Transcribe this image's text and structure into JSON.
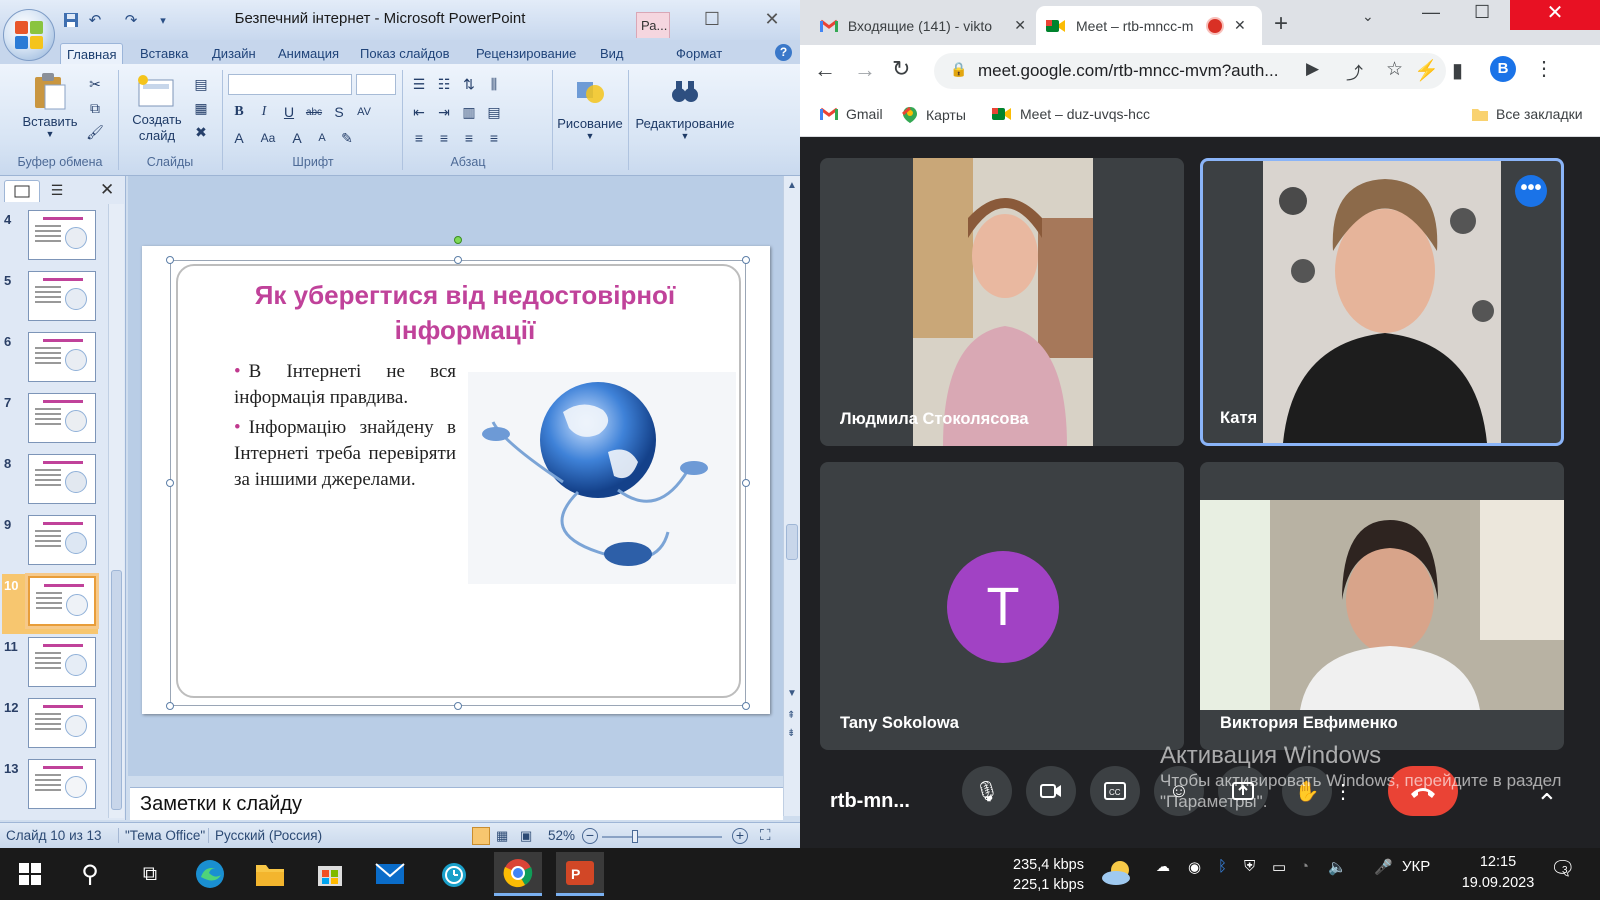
{
  "powerpoint": {
    "window_title": "Безпечний інтернет - Microsoft PowerPoint",
    "context_tab": "Ра...",
    "tabs": [
      "Главная",
      "Вставка",
      "Дизайн",
      "Анимация",
      "Показ слайдов",
      "Рецензирование",
      "Вид",
      "Формат"
    ],
    "active_tab": "Главная",
    "ribbon": {
      "paste": "Вставить",
      "create_slide": "Создать слайд",
      "drawing": "Рисование",
      "editing": "Редактирование",
      "font_buttons": [
        "B",
        "I",
        "U",
        "abc",
        "S",
        "AV"
      ],
      "groups": [
        "Буфер обмена",
        "Слайды",
        "Шрифт",
        "Абзац"
      ]
    },
    "thumbnails": [
      {
        "num": "4"
      },
      {
        "num": "5"
      },
      {
        "num": "6"
      },
      {
        "num": "7"
      },
      {
        "num": "8"
      },
      {
        "num": "9"
      },
      {
        "num": "10"
      },
      {
        "num": "11"
      },
      {
        "num": "12"
      },
      {
        "num": "13"
      }
    ],
    "selected_slide": "10",
    "slide": {
      "title": "Як уберегтися від недостовірної інформації",
      "bullets": [
        "В Інтернеті не вся інформація правдива.",
        "Інформацію знайдену в Інтернеті треба перевіряти за іншими джерелами."
      ]
    },
    "notes_placeholder": "Заметки к слайду",
    "status": {
      "slide_info": "Слайд 10 из 13",
      "theme": "\"Тема Office\"",
      "language": "Русский (Россия)",
      "zoom": "52%"
    }
  },
  "chrome": {
    "tabs": [
      {
        "title": "Входящие (141) - vikto"
      },
      {
        "title": "Meet – rtb-mncc-m"
      }
    ],
    "url": "meet.google.com/rtb-mncc-mvm?auth...",
    "profile_letter": "B",
    "bookmarks": [
      "Gmail",
      "Карты",
      "Meet – duz-uvqs-hcc"
    ],
    "all_bookmarks": "Все закладки"
  },
  "meet": {
    "participants": [
      {
        "name": "Людмила Стоколясова"
      },
      {
        "name": "Катя"
      },
      {
        "name": "Tany Sokolowa",
        "avatar_letter": "T"
      },
      {
        "name": "Виктория Евфименко"
      }
    ],
    "meeting_code": "rtb-mn...",
    "activation_title": "Активация Windows",
    "activation_text": "Чтобы активировать Windows, перейдите в раздел \"Параметры\"."
  },
  "taskbar": {
    "net_up": "235,4 kbps",
    "net_down": "225,1 kbps",
    "language": "УКР",
    "time": "12:15",
    "date": "19.09.2023",
    "notifications": "3"
  },
  "colors": {
    "slide_title": "#c0429a",
    "tany_avatar": "#a142c4",
    "end_call": "#ea4335",
    "meet_bg": "#202124"
  }
}
